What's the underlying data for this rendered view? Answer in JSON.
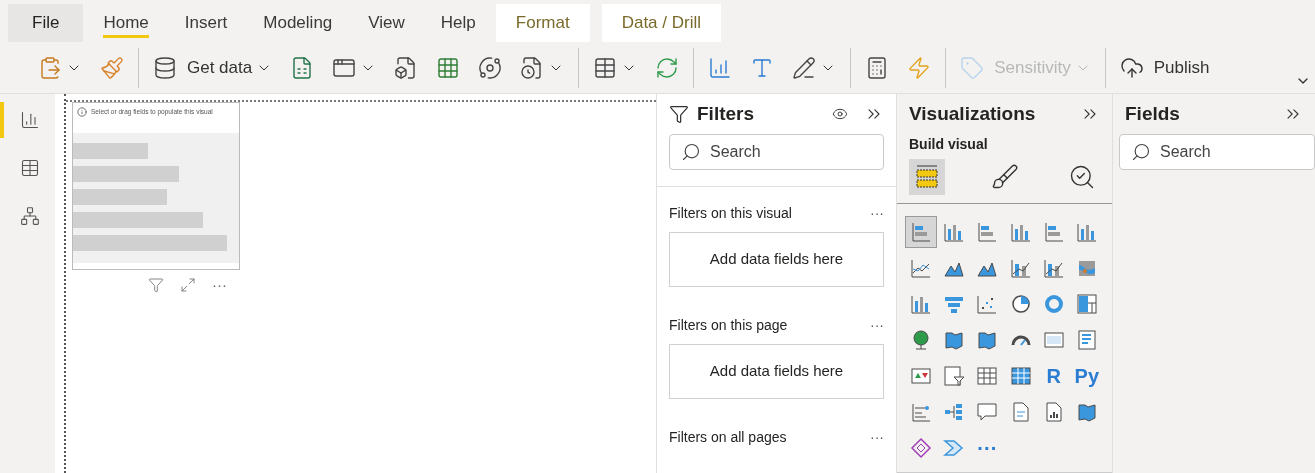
{
  "tabs": [
    {
      "label": "File",
      "kind": "file",
      "selected": false
    },
    {
      "label": "Home",
      "kind": "tab",
      "selected": true
    },
    {
      "label": "Insert",
      "kind": "tab",
      "selected": false
    },
    {
      "label": "Modeling",
      "kind": "tab",
      "selected": false
    },
    {
      "label": "View",
      "kind": "tab",
      "selected": false
    },
    {
      "label": "Help",
      "kind": "tab",
      "selected": false
    },
    {
      "label": "Format",
      "kind": "context",
      "selected": false
    },
    {
      "label": "Data / Drill",
      "kind": "context",
      "selected": false
    }
  ],
  "ribbon": {
    "groups": [
      [
        {
          "kind": "paste",
          "dropdown": true,
          "disabled": false
        },
        {
          "kind": "painter",
          "dropdown": false,
          "disabled": false
        }
      ],
      [
        {
          "kind": "database",
          "label": "Get data",
          "dropdown": true,
          "disabled": false
        },
        {
          "kind": "excel",
          "dropdown": false,
          "disabled": false
        },
        {
          "kind": "window",
          "dropdown": true,
          "disabled": false
        },
        {
          "kind": "filebox",
          "dropdown": false,
          "disabled": false
        },
        {
          "kind": "grid",
          "dropdown": false,
          "disabled": false
        },
        {
          "kind": "orbit",
          "dropdown": false,
          "disabled": false
        },
        {
          "kind": "fileclock",
          "dropdown": true,
          "disabled": false
        }
      ],
      [
        {
          "kind": "table",
          "dropdown": true,
          "disabled": false
        },
        {
          "kind": "refresh",
          "dropdown": false,
          "disabled": false
        }
      ],
      [
        {
          "kind": "chart",
          "dropdown": false,
          "disabled": false
        },
        {
          "kind": "text",
          "dropdown": false,
          "disabled": false
        },
        {
          "kind": "pencil",
          "dropdown": true,
          "disabled": false
        }
      ],
      [
        {
          "kind": "calculator",
          "dropdown": false,
          "disabled": false
        },
        {
          "kind": "lightning",
          "dropdown": false,
          "disabled": false
        }
      ],
      [
        {
          "kind": "tag",
          "label": "Sensitivity",
          "dropdown": true,
          "disabled": true
        }
      ],
      [
        {
          "kind": "upload",
          "label": "Publish",
          "dropdown": false,
          "disabled": false
        }
      ]
    ]
  },
  "nav": [
    {
      "kind": "report",
      "selected": true
    },
    {
      "kind": "table",
      "selected": false
    },
    {
      "kind": "model",
      "selected": false
    }
  ],
  "visual": {
    "hint": "Select or drag fields to populate this visual",
    "more": "···"
  },
  "filters": {
    "title": "Filters",
    "search": {
      "placeholder": "Search"
    },
    "sections": [
      {
        "label": "Filters on this visual",
        "more": "···",
        "drop": "Add data fields here"
      },
      {
        "label": "Filters on this page",
        "more": "···",
        "drop": "Add data fields here"
      },
      {
        "label": "Filters on all pages",
        "more": "···"
      }
    ]
  },
  "visualizations": {
    "title": "Visualizations",
    "subtitle": "Build visual",
    "modes": [
      {
        "kind": "fields",
        "selected": true
      },
      {
        "kind": "format",
        "selected": false
      },
      {
        "kind": "analytics",
        "selected": false
      }
    ],
    "icons": [
      {
        "kind": "hbar",
        "selected": true
      },
      {
        "kind": "vbar",
        "selected": false
      },
      {
        "kind": "hbar",
        "selected": false
      },
      {
        "kind": "vbar",
        "selected": false
      },
      {
        "kind": "hbar",
        "selected": false
      },
      {
        "kind": "vbar",
        "selected": false
      },
      {
        "kind": "line",
        "selected": false
      },
      {
        "kind": "area",
        "selected": false
      },
      {
        "kind": "area",
        "selected": false
      },
      {
        "kind": "combo",
        "selected": false
      },
      {
        "kind": "combo",
        "selected": false
      },
      {
        "kind": "ribbon",
        "selected": false
      },
      {
        "kind": "vbar",
        "selected": false
      },
      {
        "kind": "funnel",
        "selected": false
      },
      {
        "kind": "scatter",
        "selected": false
      },
      {
        "kind": "pie",
        "selected": false
      },
      {
        "kind": "donut",
        "selected": false
      },
      {
        "kind": "treemap",
        "selected": false
      },
      {
        "kind": "globe",
        "selected": false
      },
      {
        "kind": "map",
        "selected": false
      },
      {
        "kind": "map",
        "selected": false
      },
      {
        "kind": "gauge",
        "selected": false
      },
      {
        "kind": "card",
        "selected": false
      },
      {
        "kind": "list",
        "selected": false
      },
      {
        "kind": "kpi",
        "selected": false
      },
      {
        "kind": "slicer",
        "selected": false
      },
      {
        "kind": "table",
        "selected": false
      },
      {
        "kind": "matrix",
        "selected": false
      },
      {
        "kind": "text",
        "label": "R",
        "selected": false
      },
      {
        "kind": "text",
        "label": "Py",
        "selected": false
      },
      {
        "kind": "influencers",
        "selected": false
      },
      {
        "kind": "tree",
        "selected": false
      },
      {
        "kind": "chat",
        "selected": false
      },
      {
        "kind": "doc",
        "selected": false
      },
      {
        "kind": "report",
        "selected": false
      },
      {
        "kind": "map",
        "selected": false
      },
      {
        "kind": "diamond",
        "selected": false
      },
      {
        "kind": "chevron",
        "selected": false
      },
      {
        "kind": "text",
        "label": "···",
        "selected": false
      }
    ]
  },
  "fields": {
    "title": "Fields",
    "search": {
      "placeholder": "Search"
    }
  }
}
